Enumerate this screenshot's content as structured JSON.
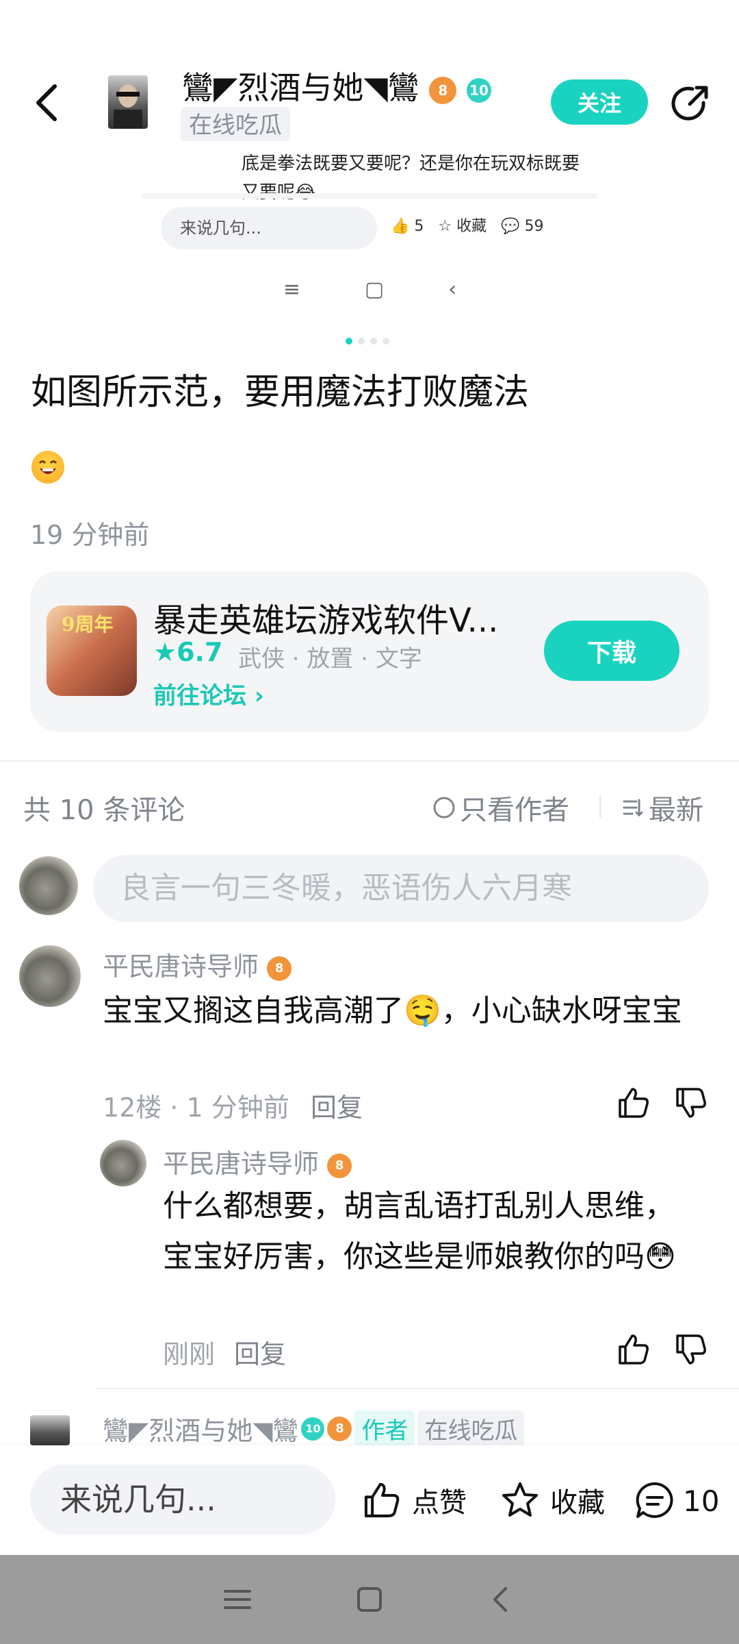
{
  "header": {
    "username": "鸞◤烈酒与她◥鸞",
    "level_badge_orange": "8",
    "level_badge_teal": "10",
    "tag": "在线吃瓜",
    "follow_label": "关注"
  },
  "post_image": {
    "text": "底是拳法既要又要呢？还是你在玩双标既要又要呢😂",
    "input_placeholder": "来说几句...",
    "likes": "5",
    "fav_label": "收藏",
    "comments": "59"
  },
  "post": {
    "title": "如图所示范，要用魔法打败魔法",
    "time": "19 分钟前"
  },
  "app_card": {
    "name": "暴走英雄坛游戏软件V...",
    "rating": "6.7",
    "tags": "武侠 · 放置 · 文字",
    "forum_link": "前往论坛",
    "download_label": "下载",
    "icon_text": "9周年"
  },
  "comments_header": {
    "count": "共 10 条评论",
    "only_author": "只看作者",
    "sort": "最新"
  },
  "comment_input": {
    "placeholder": "良言一句三冬暖，恶语伤人六月寒"
  },
  "comments": [
    {
      "name": "平民唐诗导师",
      "level": "8",
      "text": "宝宝又搁这自我高潮了🤤，小心缺水呀宝宝",
      "meta": "12楼 · 1 分钟前",
      "reply_label": "回复",
      "replies": [
        {
          "name": "平民唐诗导师",
          "level": "8",
          "text": "什么都想要，胡言乱语打乱别人思维，宝宝好厉害，你这些是师娘教你的吗😳",
          "meta": "刚刚",
          "reply_label": "回复"
        }
      ]
    },
    {
      "name": "鸞◤烈酒与她◥鸞",
      "level_teal": "10",
      "level_orange": "8",
      "author_tag": "作者",
      "online_tag": "在线吃瓜"
    }
  ],
  "bottom_bar": {
    "input_placeholder": "来说几句...",
    "like_label": "点赞",
    "fav_label": "收藏",
    "comment_count": "10"
  },
  "colors": {
    "accent": "#19d3c0",
    "text_muted": "#8f949c",
    "badge_orange": "#f2943a",
    "nav_bar": "#9c9c9c"
  }
}
